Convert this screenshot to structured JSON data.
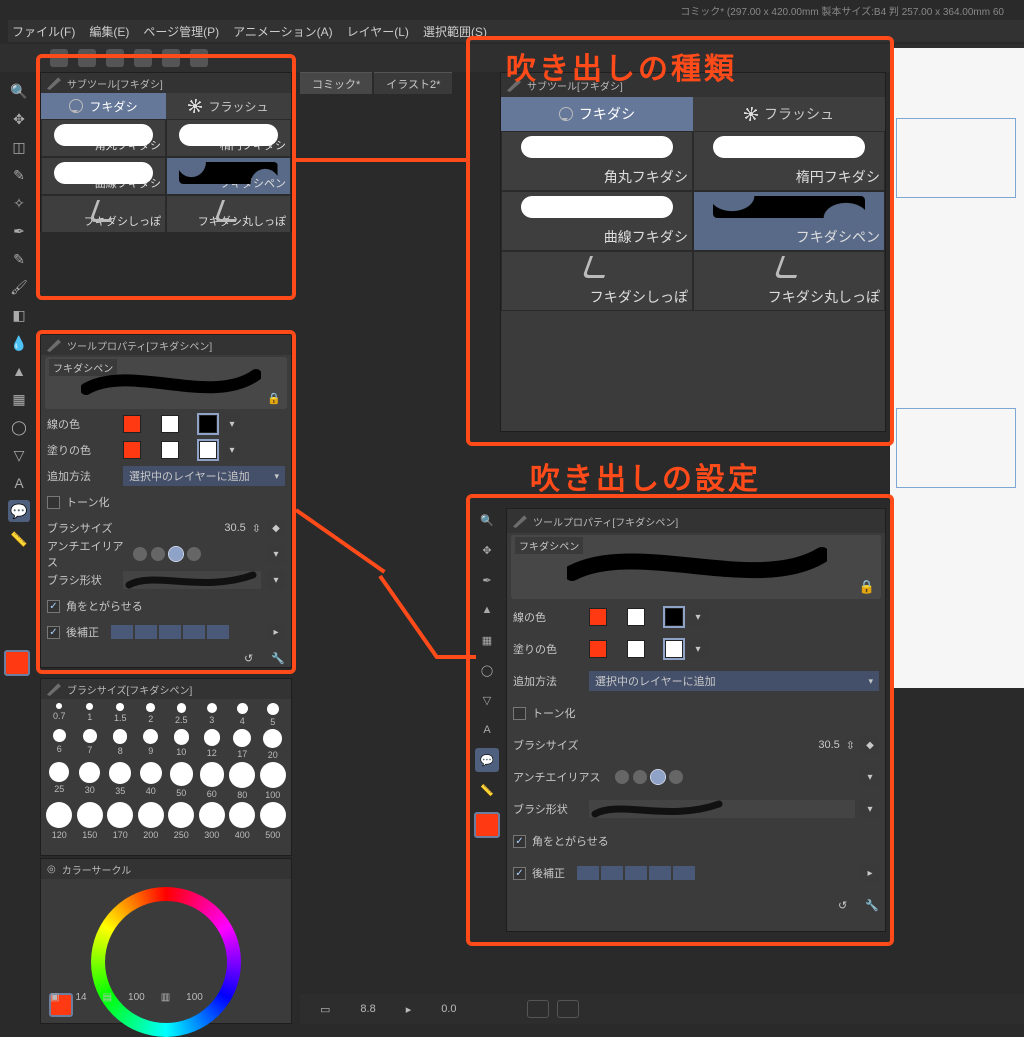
{
  "title_info": "コミック* (297.00 x 420.00mm 製本サイズ:B4 判 257.00 x 364.00mm 60",
  "menubar": [
    "ファイル(F)",
    "編集(E)",
    "ページ管理(P)",
    "アニメーション(A)",
    "レイヤー(L)",
    "選択範囲(S)"
  ],
  "doc_tabs": [
    "コミック*",
    "イラスト2*"
  ],
  "callouts": {
    "types": "吹き出しの種類",
    "settings": "吹き出しの設定"
  },
  "subtool": {
    "panel_title": "サブツール[フキダシ]",
    "tabs": {
      "balloon": "フキダシ",
      "flash": "フラッシュ"
    },
    "items": [
      {
        "label": "角丸フキダシ",
        "thumb": "ellipse"
      },
      {
        "label": "楕円フキダシ",
        "thumb": "ellipse"
      },
      {
        "label": "曲線フキダシ",
        "thumb": "ellipse"
      },
      {
        "label": "フキダシペン",
        "thumb": "squiggle",
        "selected": true
      },
      {
        "label": "フキダシしっぽ",
        "thumb": "tail"
      },
      {
        "label": "フキダシ丸しっぽ",
        "thumb": "tail"
      }
    ]
  },
  "toolprop": {
    "panel_title": "ツールプロパティ[フキダシペン]",
    "preview_label": "フキダシペン",
    "line_color": {
      "label": "線の色",
      "swatches": [
        "#ff3a12",
        "#ffffff",
        "#000000"
      ]
    },
    "fill_color": {
      "label": "塗りの色",
      "swatches": [
        "#ff3a12",
        "#ffffff",
        "#ffffff"
      ]
    },
    "add_method": {
      "label": "追加方法",
      "value": "選択中のレイヤーに追加"
    },
    "tone": {
      "label": "トーン化",
      "checked": false
    },
    "brush_size": {
      "label": "ブラシサイズ",
      "value": "30.5"
    },
    "antialias": {
      "label": "アンチエイリアス",
      "selected_index": 2
    },
    "brush_shape": {
      "label": "ブラシ形状"
    },
    "sharp_corners": {
      "label": "角をとがらせる",
      "checked": true
    },
    "post_correction": {
      "label": "後補正",
      "checked": true
    }
  },
  "brush_sizes": {
    "panel_title": "ブラシサイズ[フキダシペン]",
    "sizes": [
      0.7,
      1,
      1.5,
      2,
      2.5,
      3,
      4,
      5,
      6,
      7,
      8,
      9,
      10,
      12,
      17,
      20,
      25,
      30,
      35,
      40,
      50,
      60,
      80,
      100,
      120,
      150,
      170,
      200,
      250,
      300,
      400,
      500
    ]
  },
  "color_circle": {
    "panel_title": "カラーサークル"
  },
  "fg_color": "#ff3a12",
  "status": {
    "zoom": "8.8",
    "rot": "0.0",
    "mini1": "14",
    "mini2": "100",
    "mini3": "100"
  },
  "tools_left": [
    {
      "n": "magnifier-icon",
      "g": "🔍"
    },
    {
      "n": "move-icon",
      "g": "✥"
    },
    {
      "n": "transform-icon",
      "g": "◫"
    },
    {
      "n": "lasso-icon",
      "g": "✎"
    },
    {
      "n": "wand-icon",
      "g": "✧"
    },
    {
      "n": "pen-icon",
      "g": "✒"
    },
    {
      "n": "pencil-icon",
      "g": "✎"
    },
    {
      "n": "brush-icon",
      "g": "🖌"
    },
    {
      "n": "eraser-icon",
      "g": "◧"
    },
    {
      "n": "blend-icon",
      "g": "💧"
    },
    {
      "n": "fill-icon",
      "g": "▲"
    },
    {
      "n": "gradient-icon",
      "g": "▦"
    },
    {
      "n": "figure-icon",
      "g": "◯"
    },
    {
      "n": "shape-icon",
      "g": "▽"
    },
    {
      "n": "text-icon",
      "g": "A"
    },
    {
      "n": "balloon-icon",
      "g": "💬",
      "sel": true
    },
    {
      "n": "ruler-icon",
      "g": "📏"
    }
  ],
  "tools_mid": [
    {
      "n": "mid-magnifier-icon",
      "g": "🔍"
    },
    {
      "n": "mid-hand-icon",
      "g": "✥"
    },
    {
      "n": "mid-pen-icon",
      "g": "✒"
    },
    {
      "n": "mid-fill-icon",
      "g": "▲"
    },
    {
      "n": "mid-blend-icon",
      "g": "▦"
    },
    {
      "n": "mid-shape-icon",
      "g": "◯"
    },
    {
      "n": "mid-poly-icon",
      "g": "▽"
    },
    {
      "n": "mid-text-icon",
      "g": "A"
    },
    {
      "n": "mid-balloon-icon",
      "g": "💬",
      "sel": true
    },
    {
      "n": "mid-ruler-icon",
      "g": "📏"
    }
  ]
}
